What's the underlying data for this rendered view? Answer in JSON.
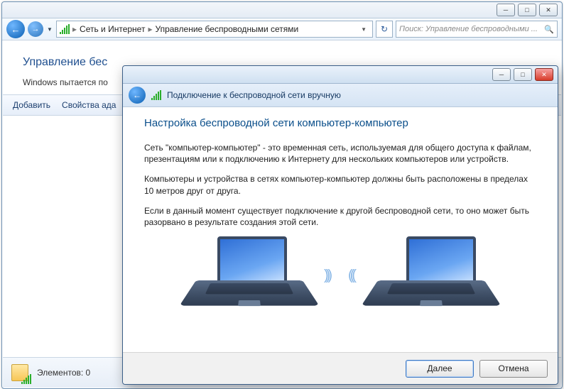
{
  "explorer": {
    "breadcrumb": {
      "seg1": "Сеть и Интернет",
      "seg2": "Управление беспроводными сетями"
    },
    "search_placeholder": "Поиск: Управление беспроводными ...",
    "page_title": "Управление бес",
    "page_sub": "Windows пытается по",
    "cmd": {
      "add": "Добавить",
      "props": "Свойства ада"
    },
    "status_label": "Элементов: 0"
  },
  "dialog": {
    "header": "Подключение к беспроводной сети вручную",
    "title": "Настройка беспроводной сети компьютер-компьютер",
    "p1": "Сеть \"компьютер-компьютер\" - это временная сеть, используемая для общего доступа к файлам, презентациям или к подключению к Интернету для нескольких компьютеров или устройств.",
    "p2": "Компьютеры и устройства в сетях компьютер-компьютер должны быть расположены в пределах 10 метров друг от друга.",
    "p3": "Если в данный момент существует подключение к другой беспроводной сети, то оно может быть разорвано в результате создания этой сети.",
    "next": "Далее",
    "cancel": "Отмена"
  }
}
